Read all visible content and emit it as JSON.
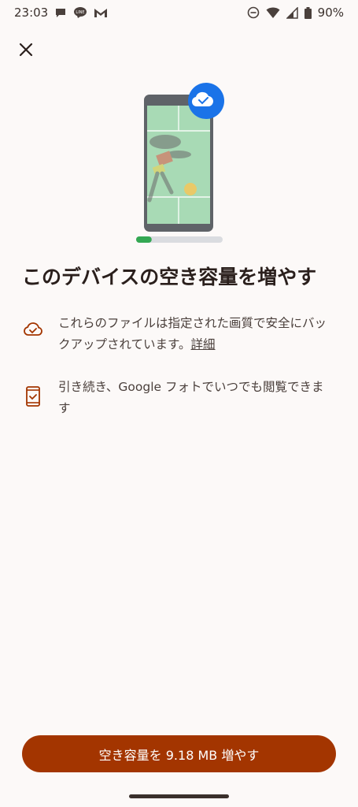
{
  "status_bar": {
    "time": "23:03",
    "battery": "90%",
    "icons_left": [
      "chat-bubble-icon",
      "line-app-icon",
      "gmail-icon"
    ],
    "icons_right": [
      "dnd-icon",
      "wifi-icon",
      "signal-icon",
      "battery-icon"
    ]
  },
  "header": {
    "close_icon": "close-icon"
  },
  "illustration": {
    "progress": 0.18,
    "badge_icon": "cloud-check-icon",
    "colors": {
      "phone": "#5f6368",
      "screen": "#a8dab5",
      "badge": "#1a73e8",
      "progress_fill": "#34a853",
      "progress_track": "#dadce0"
    }
  },
  "main": {
    "title": "このデバイスの空き容量を増やす",
    "items": [
      {
        "icon": "cloud-check-icon",
        "text": "これらのファイルは指定された画質で安全にバックアップされています。",
        "link": "詳細"
      },
      {
        "icon": "phone-check-icon",
        "text": "引き続き、Google フォトでいつでも閲覧できます"
      }
    ]
  },
  "footer": {
    "cta_label": "空き容量を 9.18 MB 増やす",
    "accent": "#a33500"
  }
}
